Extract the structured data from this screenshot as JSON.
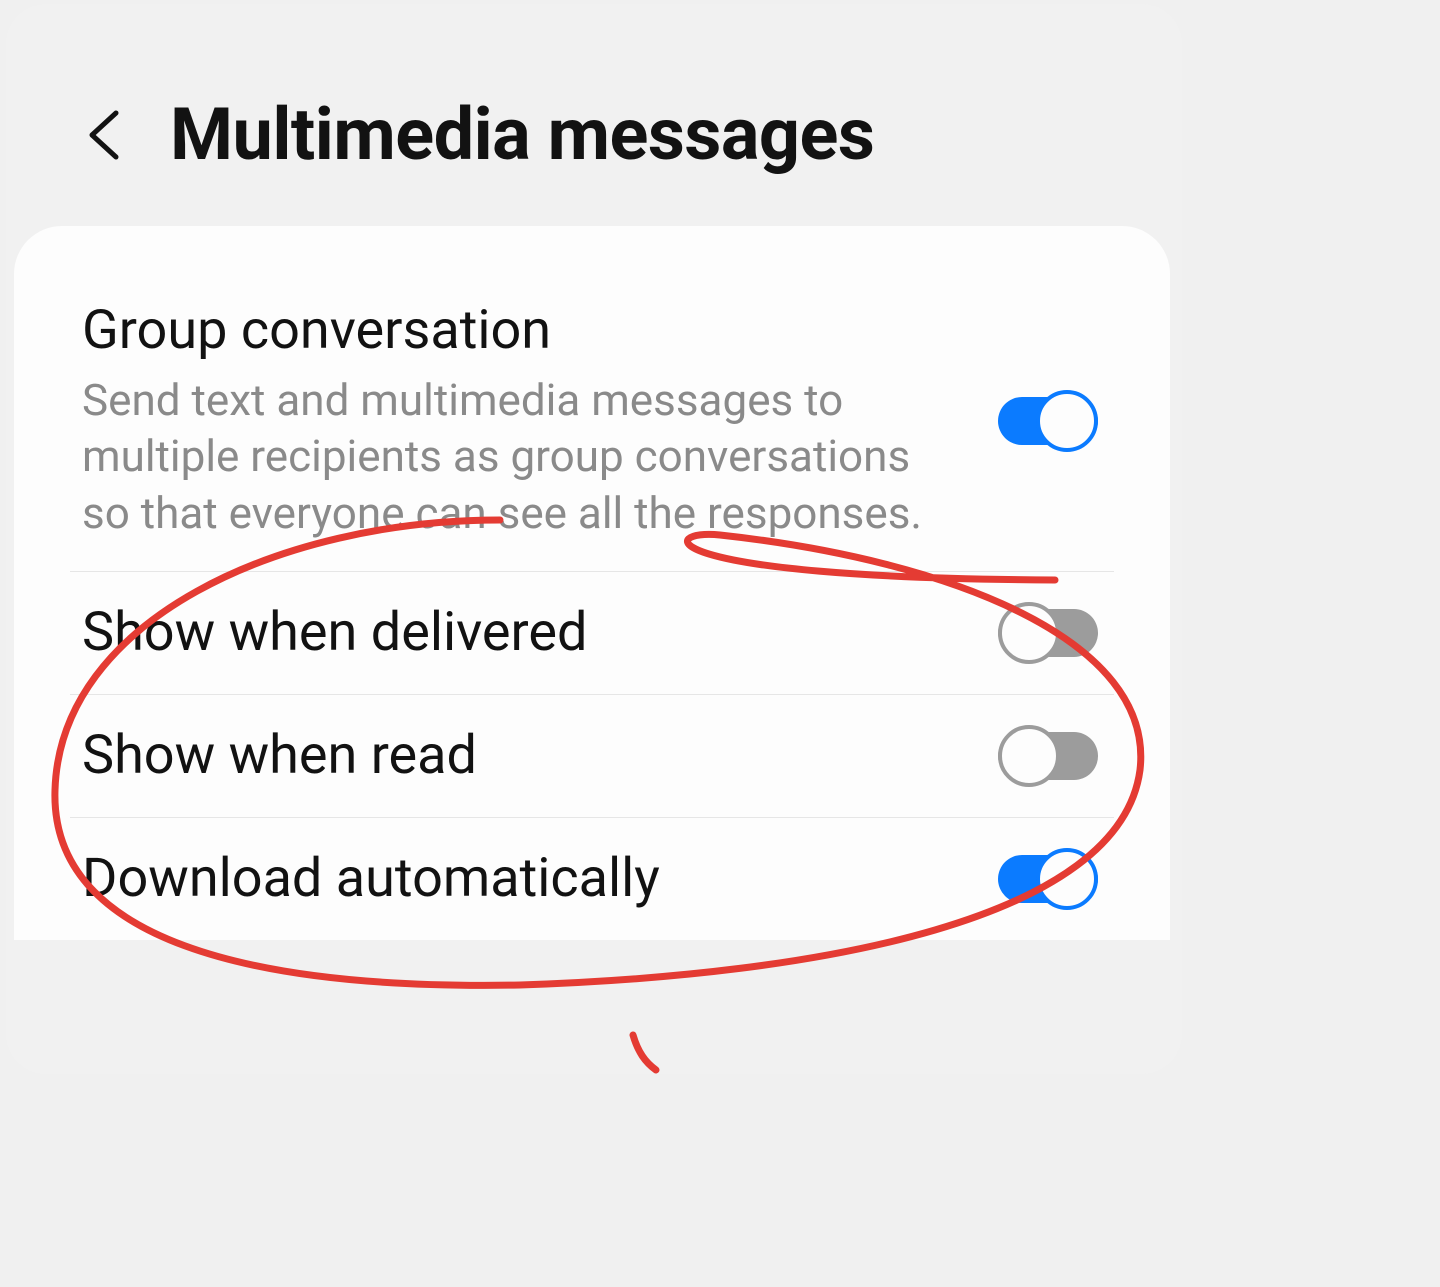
{
  "header": {
    "title": "Multimedia messages"
  },
  "settings": {
    "group_conversation": {
      "title": "Group conversation",
      "subtitle": "Send text and multimedia messages to multiple recipients as group conversations so that everyone can see all the responses.",
      "on": true
    },
    "show_when_delivered": {
      "title": "Show when delivered",
      "on": false
    },
    "show_when_read": {
      "title": "Show when read",
      "on": false
    },
    "download_automatically": {
      "title": "Download automatically",
      "on": true
    }
  },
  "colors": {
    "accent": "#0b7bff",
    "toggle_off": "#9c9c9c",
    "annotation": "#e43b33"
  },
  "annotation": {
    "type": "hand-drawn-circle",
    "targets": [
      "show_when_delivered",
      "show_when_read"
    ]
  }
}
